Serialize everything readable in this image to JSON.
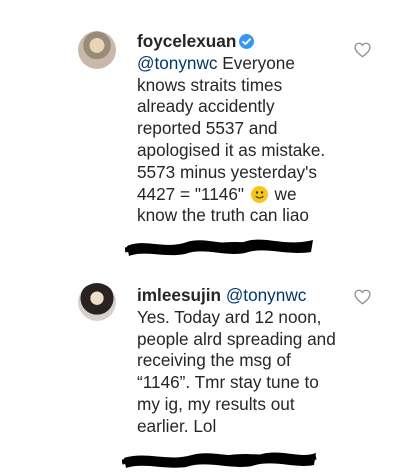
{
  "comments": [
    {
      "username": "foycelexuan",
      "verified": true,
      "mention": "@tonynwc",
      "text_before_emoji": " Everyone knows straits times already accidently reported 5537 and apologised it as mistake. 5573 minus yesterday's 4427 = \"1146\" ",
      "emoji": "slightly-smiling-face",
      "text_after_emoji": " we know the truth can liao"
    },
    {
      "username": "imleesujin",
      "verified": false,
      "mention": "@tonynwc",
      "text": " Yes. Today ard 12 noon, people alrd spreading and receiving the msg of “1146”. Tmr stay tune to my ig, my results out earlier. Lol"
    }
  ],
  "colors": {
    "text": "#262626",
    "mention": "#00376b",
    "verified_badge": "#3897f0",
    "redaction": "#000000"
  }
}
